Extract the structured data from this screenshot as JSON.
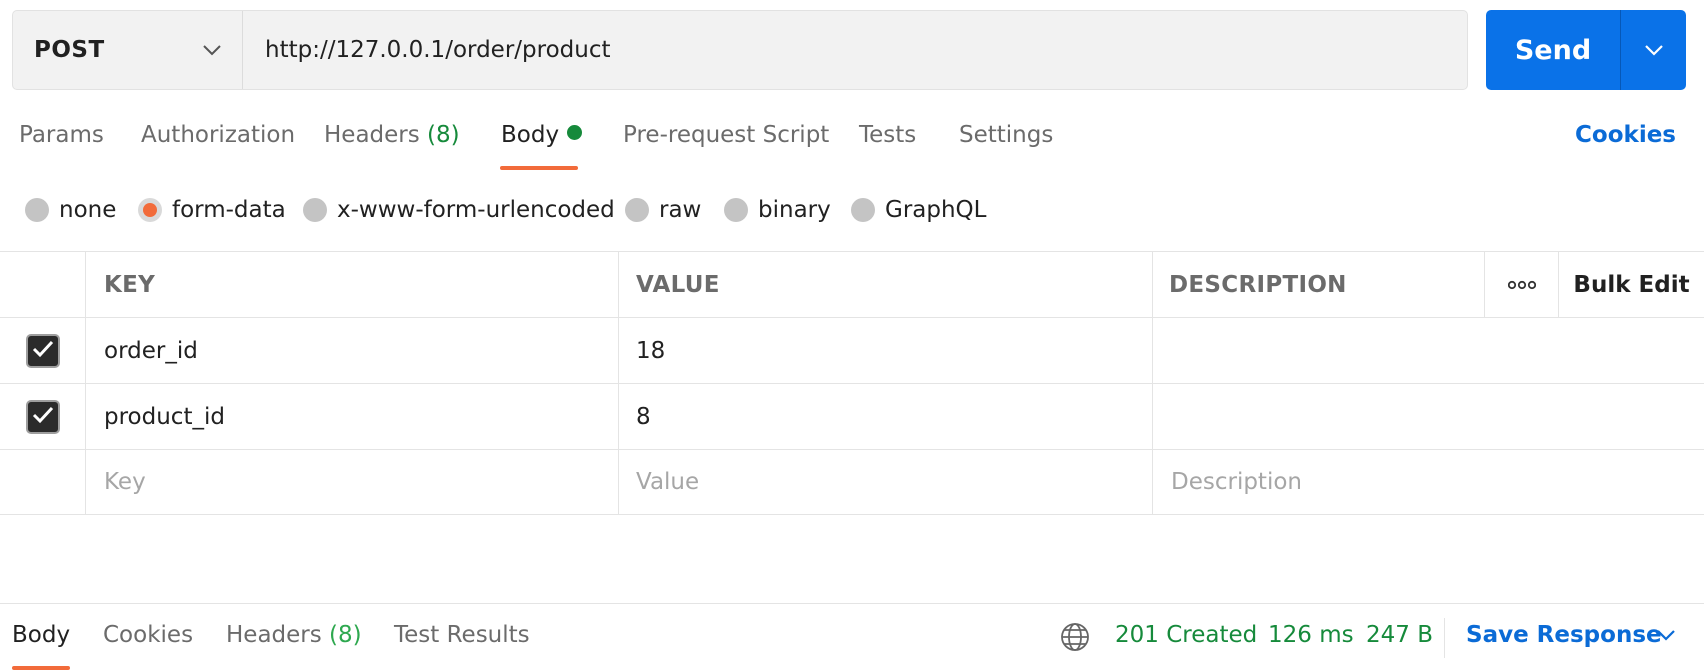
{
  "request": {
    "method": "POST",
    "url": "http://127.0.0.1/order/product",
    "send_label": "Send"
  },
  "request_tabs": {
    "params": "Params",
    "authorization": "Authorization",
    "headers": "Headers",
    "headers_count": "(8)",
    "body": "Body",
    "prerequest": "Pre-request Script",
    "tests": "Tests",
    "settings": "Settings",
    "cookies": "Cookies"
  },
  "body_types": {
    "none": "none",
    "form_data": "form-data",
    "urlencoded": "x-www-form-urlencoded",
    "raw": "raw",
    "binary": "binary",
    "graphql": "GraphQL",
    "selected": "form-data"
  },
  "table": {
    "headers": {
      "key": "KEY",
      "value": "VALUE",
      "description": "DESCRIPTION",
      "bulk_edit": "Bulk Edit"
    },
    "rows": [
      {
        "checked": true,
        "key": "order_id",
        "value": "18",
        "description": ""
      },
      {
        "checked": true,
        "key": "product_id",
        "value": "8",
        "description": ""
      }
    ],
    "placeholders": {
      "key": "Key",
      "value": "Value",
      "description": "Description"
    }
  },
  "response": {
    "tabs": {
      "body": "Body",
      "cookies": "Cookies",
      "headers": "Headers",
      "headers_count": "(8)",
      "test_results": "Test Results"
    },
    "status": "201 Created",
    "time": "126 ms",
    "size": "247 B",
    "save_label": "Save Response"
  },
  "colors": {
    "accent_blue": "#0a72e8",
    "link_blue": "#0b6bd6",
    "active_orange": "#f26b3a",
    "success_green": "#168a3b"
  },
  "icons": {
    "method_dropdown": "chevron-down-icon",
    "send_dropdown": "chevron-down-icon",
    "more": "ellipsis-icon",
    "checkbox": "check-icon",
    "network": "globe-icon",
    "save_dropdown": "chevron-down-icon"
  }
}
